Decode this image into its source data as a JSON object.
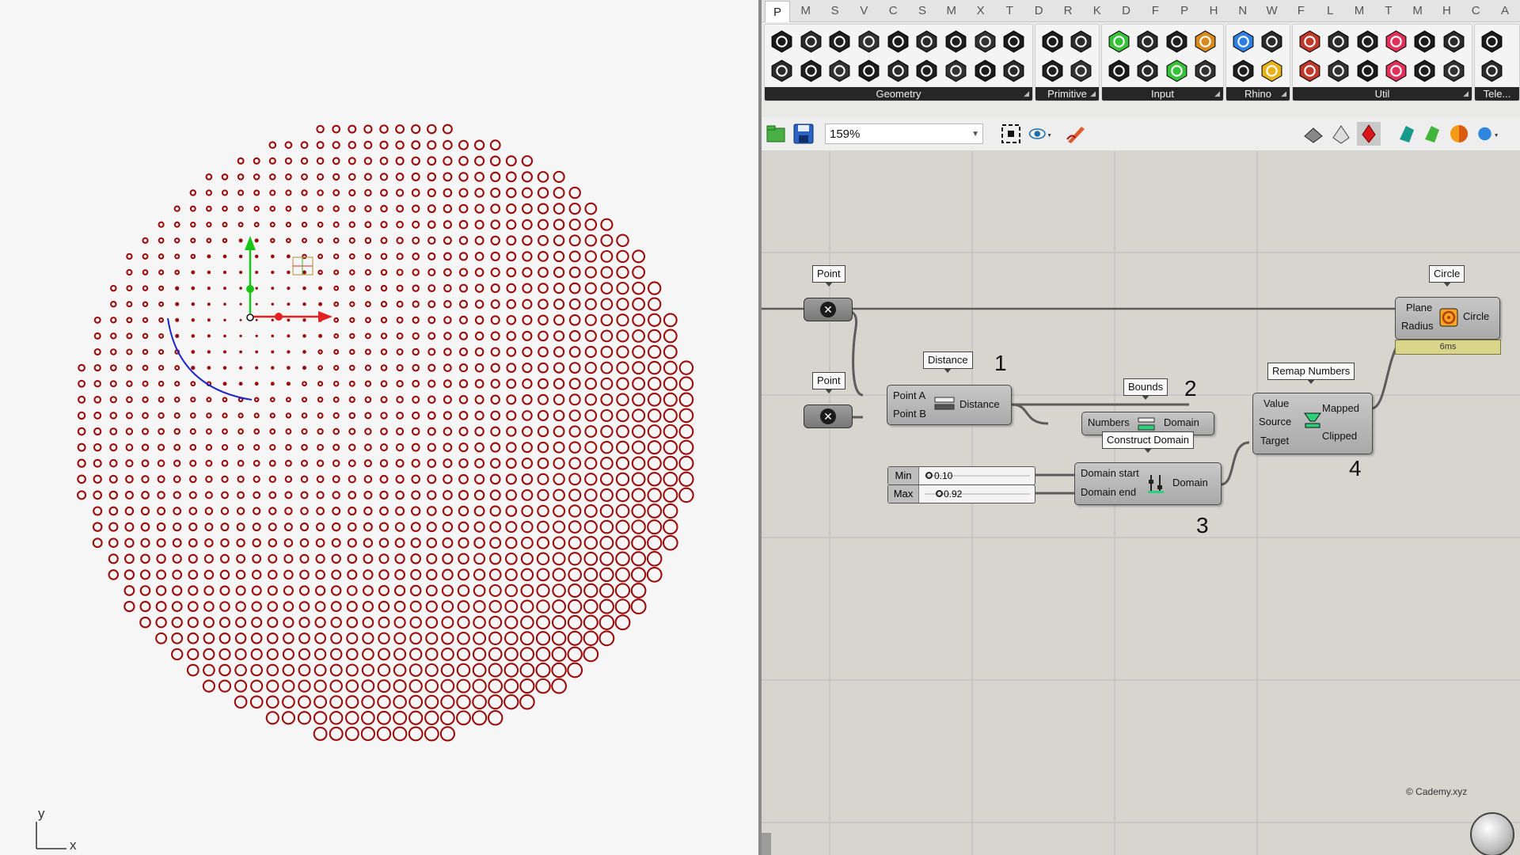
{
  "viewport": {
    "axis_x_label": "x",
    "axis_y_label": "y",
    "circle_color": "#9b0d0d",
    "gizmo": {
      "x_axis_color": "#e52020",
      "y_axis_color": "#19c519",
      "curve_color": "#1a23cc"
    }
  },
  "grasshopper": {
    "tabs": [
      "P",
      "M",
      "S",
      "V",
      "C",
      "S",
      "M",
      "X",
      "T",
      "D",
      "R",
      "K",
      "D",
      "F",
      "P",
      "H",
      "N",
      "W",
      "F",
      "L",
      "M",
      "T",
      "M",
      "H",
      "C",
      "A"
    ],
    "active_tab_index": 0,
    "ribbon_groups": [
      {
        "label": "Geometry",
        "icon_count": 18
      },
      {
        "label": "Primitive",
        "icon_count": 4
      },
      {
        "label": "Input",
        "icon_count": 8
      },
      {
        "label": "Rhino",
        "icon_count": 4
      },
      {
        "label": "Util",
        "icon_count": 12
      },
      {
        "label": "Tele...",
        "icon_count": 2
      }
    ],
    "toolbar": {
      "zoom": "159%"
    },
    "canvas": {
      "point_a_label": "Point",
      "point_b_label": "Point",
      "distance": {
        "nickname": "Distance",
        "input_a": "Point A",
        "input_b": "Point B",
        "output": "Distance",
        "step": "1"
      },
      "bounds": {
        "nickname": "Bounds",
        "input": "Numbers",
        "output": "Domain",
        "step": "2"
      },
      "construct_domain": {
        "nickname": "Construct Domain",
        "input_start": "Domain start",
        "input_end": "Domain end",
        "output": "Domain",
        "step": "3"
      },
      "slider_min": {
        "tag": "Min",
        "value": "0.10",
        "fraction": 0.1
      },
      "slider_max": {
        "tag": "Max",
        "value": "0.92",
        "fraction": 0.92
      },
      "remap": {
        "nickname": "Remap Numbers",
        "input_value": "Value",
        "input_source": "Source",
        "input_target": "Target",
        "output_mapped": "Mapped",
        "output_clipped": "Clipped",
        "step": "4"
      },
      "circle": {
        "nickname": "Circle",
        "input_plane": "Plane",
        "input_radius": "Radius",
        "output": "Circle",
        "timing": "6ms"
      },
      "credit": "© Cademy.xyz"
    }
  }
}
